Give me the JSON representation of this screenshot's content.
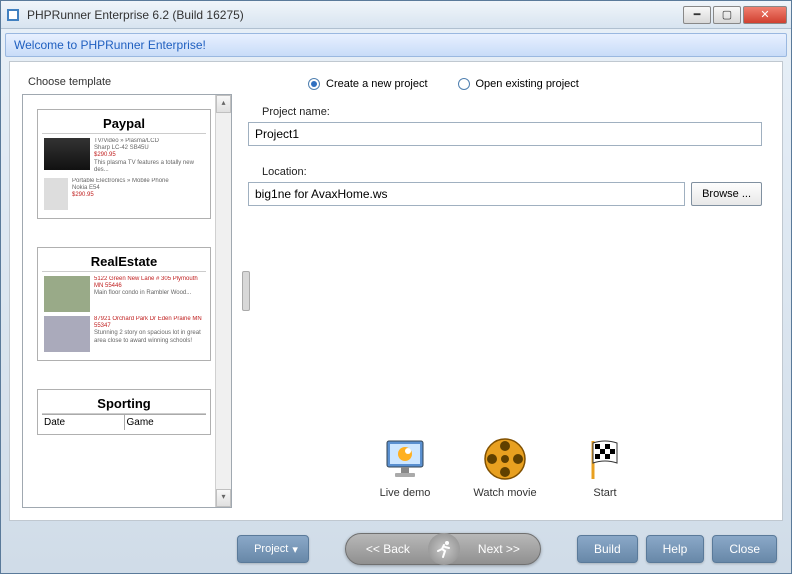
{
  "window": {
    "title": "PHPRunner Enterprise 6.2 (Build 16275)"
  },
  "banner": "Welcome to PHPRunner Enterprise!",
  "left": {
    "header": "Choose template"
  },
  "templates": [
    {
      "name": "Paypal"
    },
    {
      "name": "RealEstate"
    },
    {
      "name": "Sporting",
      "cols": [
        "Date",
        "Game"
      ]
    }
  ],
  "radios": {
    "create": "Create a new project",
    "open": "Open existing project"
  },
  "fields": {
    "projectNameLabel": "Project name:",
    "projectNameValue": "Project1",
    "locationLabel": "Location:",
    "locationValue": "big1ne for AvaxHome.ws",
    "browse": "Browse ..."
  },
  "actions": {
    "liveDemo": "Live demo",
    "watchMovie": "Watch movie",
    "start": "Start"
  },
  "bottom": {
    "project": "Project",
    "back": "<<  Back",
    "next": "Next  >>",
    "build": "Build",
    "help": "Help",
    "close": "Close"
  }
}
